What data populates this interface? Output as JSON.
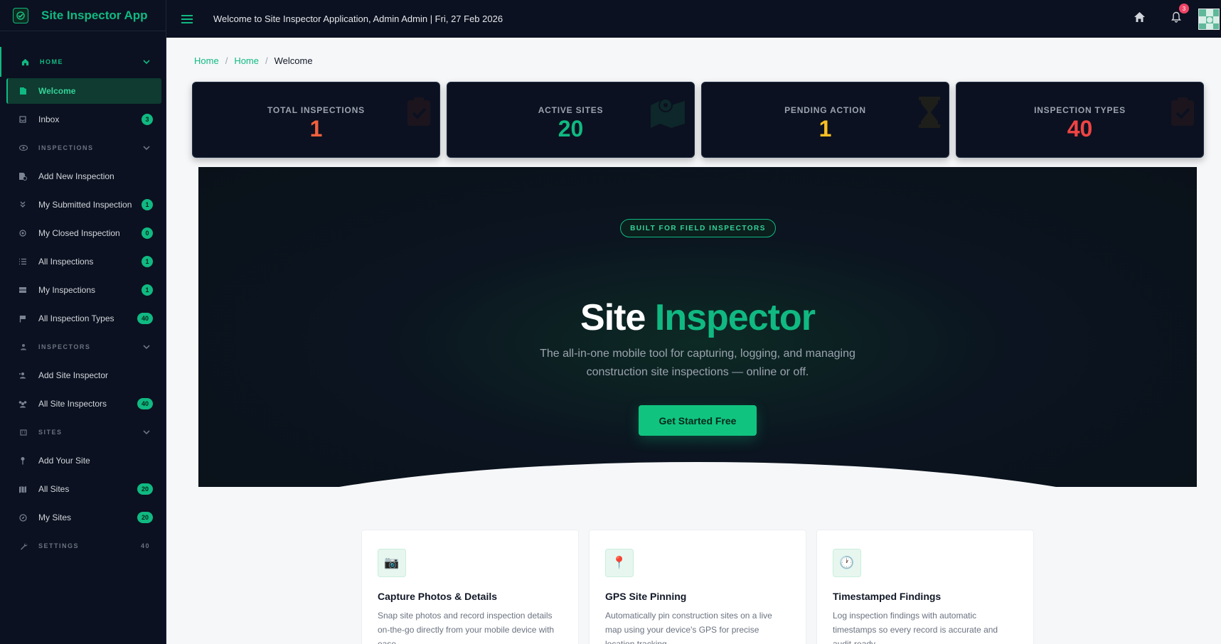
{
  "app": {
    "title": "Site Inspector App"
  },
  "topbar": {
    "welcome": "Welcome to Site Inspector Application, Admin Admin | Fri, 27 Feb 2026",
    "notification_count": "3",
    "icons": [
      "menu-icon",
      "home-icon",
      "bell-icon",
      "avatar"
    ]
  },
  "sidebar": {
    "home": {
      "label": "HOME",
      "items": [
        {
          "label": "Welcome",
          "icon": "door-icon",
          "active": true
        },
        {
          "label": "Inbox",
          "icon": "inbox-icon",
          "badge": "3"
        }
      ]
    },
    "inspections": {
      "label": "INSPECTIONS",
      "items": [
        {
          "label": "Add New Inspection",
          "icon": "file-plus-icon"
        },
        {
          "label": "My Submitted Inspection",
          "icon": "double-chevron-icon",
          "badge": "1"
        },
        {
          "label": "My Closed Inspection",
          "icon": "circle-icon",
          "badge": "0"
        },
        {
          "label": "All Inspections",
          "icon": "list-icon",
          "badge": "1"
        },
        {
          "label": "My Inspections",
          "icon": "server-icon",
          "badge": "1"
        },
        {
          "label": "All Inspection Types",
          "icon": "flag-icon",
          "badge": "40"
        }
      ]
    },
    "inspectors": {
      "label": "INSPECTORS",
      "items": [
        {
          "label": "Add Site Inspector",
          "icon": "user-plus-icon"
        },
        {
          "label": "All Site Inspectors",
          "icon": "users-icon",
          "badge": "40"
        }
      ]
    },
    "sites": {
      "label": "SITES",
      "items": [
        {
          "label": "Add Your Site",
          "icon": "pin-icon"
        },
        {
          "label": "All Sites",
          "icon": "map-icon",
          "badge": "20"
        },
        {
          "label": "My Sites",
          "icon": "compass-icon",
          "badge": "20"
        }
      ]
    },
    "settings": {
      "label": "SETTINGS",
      "count": "40"
    }
  },
  "breadcrumb": {
    "items": [
      "Home",
      "Home"
    ],
    "current": "Welcome"
  },
  "stats": [
    {
      "label": "TOTAL INSPECTIONS",
      "value": "1",
      "color": "#f2603e",
      "icon": "clipboard-check-icon"
    },
    {
      "label": "ACTIVE SITES",
      "value": "20",
      "color": "#10b981",
      "icon": "map-icon"
    },
    {
      "label": "PENDING ACTION",
      "value": "1",
      "color": "#fbbf24",
      "icon": "hourglass-icon"
    },
    {
      "label": "INSPECTION TYPES",
      "value": "40",
      "color": "#ef4444",
      "icon": "clipboard-check-icon"
    }
  ],
  "hero": {
    "pill": "BUILT FOR FIELD INSPECTORS",
    "title_main": "Site",
    "title_accent": "Inspector",
    "subtitle": "The all-in-one mobile tool for capturing, logging, and managing construction site inspections — online or off.",
    "cta": "Get Started Free"
  },
  "features": [
    {
      "icon": "camera-icon",
      "glyph": "📷",
      "title": "Capture Photos & Details",
      "desc": "Snap site photos and record inspection details on-the-go directly from your mobile device with ease."
    },
    {
      "icon": "location-pin-icon",
      "glyph": "📍",
      "title": "GPS Site Pinning",
      "desc": "Automatically pin construction sites on a live map using your device's GPS for precise location tracking."
    },
    {
      "icon": "clock-icon",
      "glyph": "🕐",
      "title": "Timestamped Findings",
      "desc": "Log inspection findings with automatic timestamps so every record is accurate and audit-ready."
    }
  ],
  "colors": {
    "accent": "#10b981",
    "sidebar_bg": "#0b1120",
    "page_bg": "#f6f7f9"
  }
}
